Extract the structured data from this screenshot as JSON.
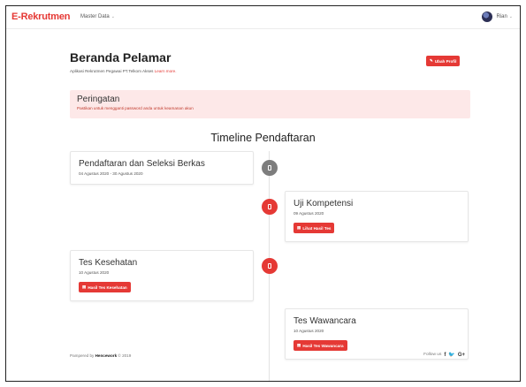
{
  "navbar": {
    "brand": "E-Rekrutmen",
    "menu_label": "Master Data",
    "user_name": "Rian"
  },
  "header": {
    "title": "Beranda Pelamar",
    "subtitle": "Aplikasi Rekrutmen Pegawai PT.Telkom Akses",
    "learn_more": "Learn more.",
    "profile_button": "Ubah Profil"
  },
  "alert": {
    "title": "Peringatan",
    "message": "Pastikan untuk mengganti password anda untuk keamanan akun"
  },
  "timeline": {
    "title": "Timeline Pendaftaran",
    "items": [
      {
        "title": "Pendaftaran dan Seleksi Berkas",
        "date": "04 Agustus 2020 - 30 Agustus 2020",
        "button": ""
      },
      {
        "title": "Uji Kompetensi",
        "date": "09 Agustus 2020",
        "button": "Lihat Hasil Tes"
      },
      {
        "title": "Tes Kesehatan",
        "date": "10 Agustus 2020",
        "button": "Hasil Tes Kesehatan"
      },
      {
        "title": "Tes Wawancara",
        "date": "10 Agustus 2020",
        "button": "Hasil Tes Wawancara"
      }
    ]
  },
  "footer": {
    "powered_prefix": "Pampered by",
    "powered_name": "Hencework",
    "powered_suffix": "© 2019",
    "follow": "Follow us",
    "social": [
      "f",
      "🐦",
      "G+"
    ]
  },
  "colors": {
    "accent": "#e53935",
    "alert_bg": "#fde8e8",
    "marker_grey": "#7d7d7d"
  }
}
